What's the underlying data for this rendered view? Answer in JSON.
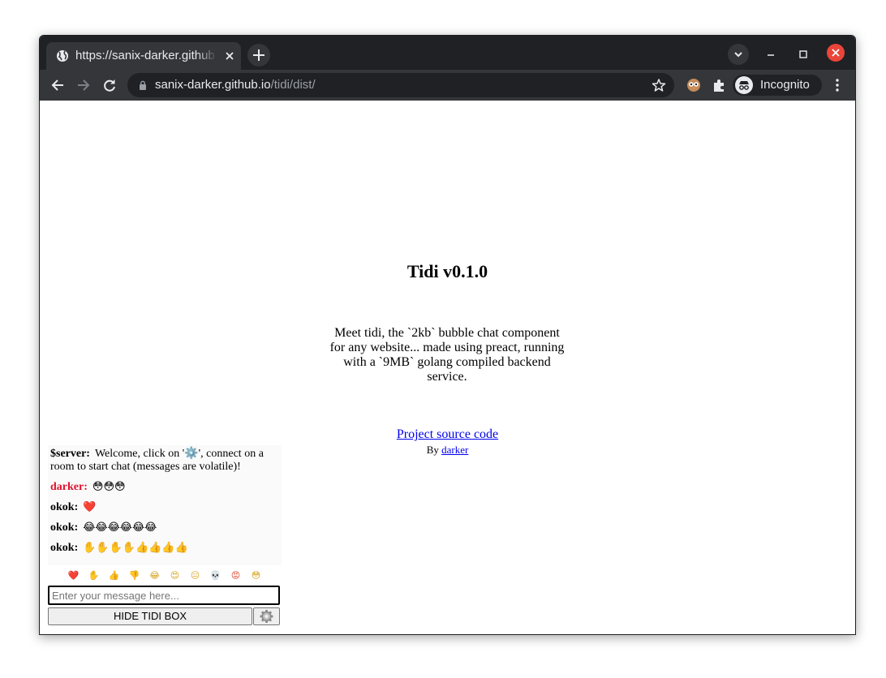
{
  "browser": {
    "tab_title": "https://sanix-darker.github.io/tidi/dist/",
    "url_host": "sanix-darker.github.io",
    "url_path": "/tidi/dist/",
    "profile_label": "Incognito",
    "icons": [
      "globe-icon",
      "close-icon",
      "plus-icon",
      "chevron-down-icon",
      "minimize-icon",
      "maximize-icon",
      "back-arrow-icon",
      "forward-arrow-icon",
      "reload-icon",
      "lock-icon",
      "star-icon",
      "extension-icon",
      "puzzle-icon",
      "incognito-icon",
      "kebab-menu-icon"
    ]
  },
  "page": {
    "title": "Tidi v0.1.0",
    "description": "Meet tidi, the `2kb` bubble chat component for any website... made using preact, running with a `9MB` golang compiled backend service.",
    "source_link": "Project source code",
    "by_prefix": "By",
    "by_author": "darker"
  },
  "chat": {
    "messages": [
      {
        "author": "$server:",
        "text": "Welcome, click on '⚙️', connect on a room to start chat (messages are volatile)!"
      },
      {
        "author": "darker:",
        "text": "😳😳😳"
      },
      {
        "author": "okok:",
        "text": "❤️"
      },
      {
        "author": "okok:",
        "text": "😂😂😂😂😂😂"
      },
      {
        "author": "okok:",
        "text": "✋✋✋✋👍👍👍👍"
      }
    ],
    "quick_emojis": [
      "❤️",
      "✋",
      "👍",
      "👎",
      "😂",
      "😍",
      "😐",
      "💀",
      "😡",
      "😳"
    ],
    "input_placeholder": "Enter your message here...",
    "hide_button_label": "HIDE TIDI BOX",
    "settings_icon": "⚙️",
    "author_colors": {
      "darker": "#e0112b",
      "default": "#000000"
    }
  }
}
